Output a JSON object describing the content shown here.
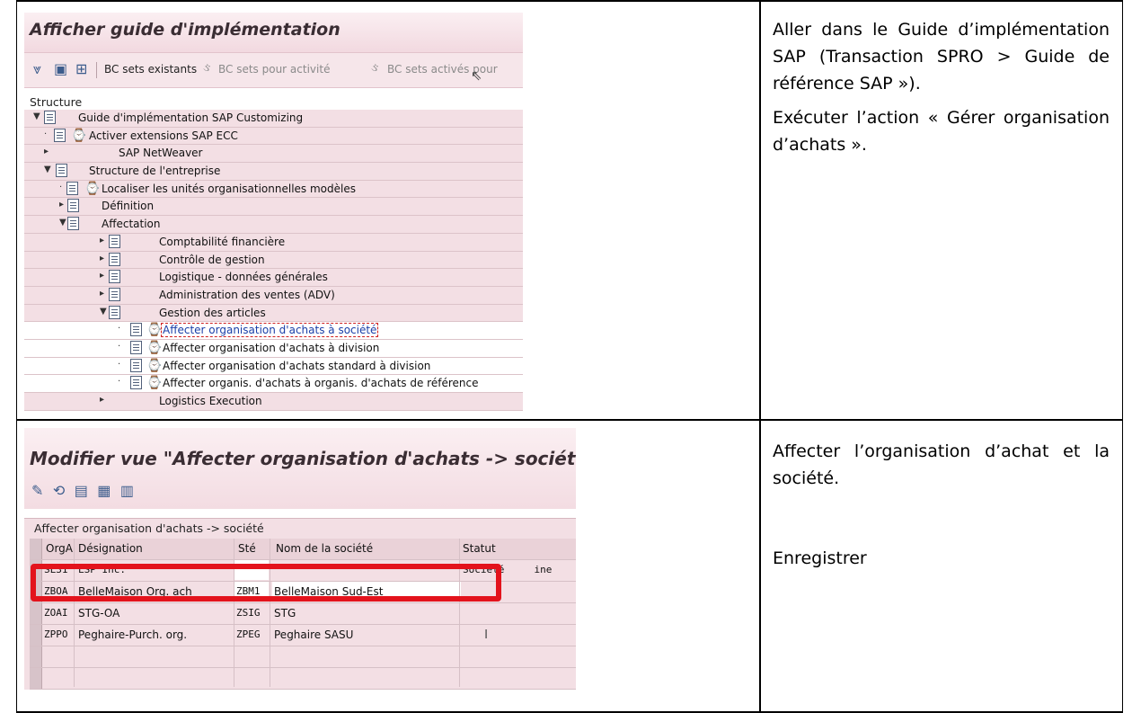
{
  "screen1": {
    "title": "Afficher guide d'implémentation",
    "toolbar": {
      "bc_sets_existants": "BC sets existants",
      "bc_sets_pour_activite": "BC sets pour activité",
      "bc_sets_actives_pour": "BC sets activés pour"
    },
    "structure_label": "Structure",
    "tree": [
      {
        "label": "Guide d'implémentation SAP Customizing"
      },
      {
        "label": "Activer extensions SAP ECC"
      },
      {
        "label": "SAP NetWeaver"
      },
      {
        "label": "Structure de l'entreprise"
      },
      {
        "label": "Localiser les unités organisationnelles modèles"
      },
      {
        "label": "Définition"
      },
      {
        "label": "Affectation"
      },
      {
        "label": "Comptabilité financière"
      },
      {
        "label": "Contrôle de gestion"
      },
      {
        "label": "Logistique - données générales"
      },
      {
        "label": "Administration des ventes (ADV)"
      },
      {
        "label": "Gestion des articles"
      },
      {
        "label": "Affecter organisation d'achats à société"
      },
      {
        "label": "Affecter organisation d'achats à division"
      },
      {
        "label": "Affecter organisation d'achats standard à division"
      },
      {
        "label": "Affecter organis. d'achats à organis. d'achats de référence"
      },
      {
        "label": "Logistics Execution"
      }
    ]
  },
  "note1": {
    "para1": "Aller dans le Guide d’implémentation SAP (Transaction SPRO > Guide de référence SAP »).",
    "para2": "Exécuter l’action « Gérer organisation d’achats »."
  },
  "screen2": {
    "title": "Modifier vue \"Affecter organisation d'achats -> société\" : s",
    "table_title": "Affecter organisation d'achats -> société",
    "headers": {
      "orga": "OrgA",
      "designation": "Désignation",
      "ste": "Sté",
      "nom": "Nom de la société",
      "statut": "Statut"
    },
    "rows": [
      {
        "orga": "SL31",
        "designation": "LSP Inc.",
        "ste": "",
        "nom": "",
        "statut": "Société     ine"
      },
      {
        "orga": "ZBOA",
        "designation": "BelleMaison Org. ach",
        "ste": "ZBM1",
        "nom": "BelleMaison Sud-Est",
        "statut": ""
      },
      {
        "orga": "ZOAI",
        "designation": "STG-OA",
        "ste": "ZSIG",
        "nom": "STG",
        "statut": ""
      },
      {
        "orga": "ZPPO",
        "designation": "Peghaire-Purch. org.",
        "ste": "ZPEG",
        "nom": "Peghaire SASU",
        "statut": ""
      }
    ]
  },
  "note2": {
    "para1": "Affecter l’organisation d’achat et la société.",
    "para2": "Enregistrer"
  },
  "colors": {
    "sap_pink": "#f3dfe4",
    "highlight_red": "#e3131c",
    "link_blue": "#1a3fa8"
  }
}
